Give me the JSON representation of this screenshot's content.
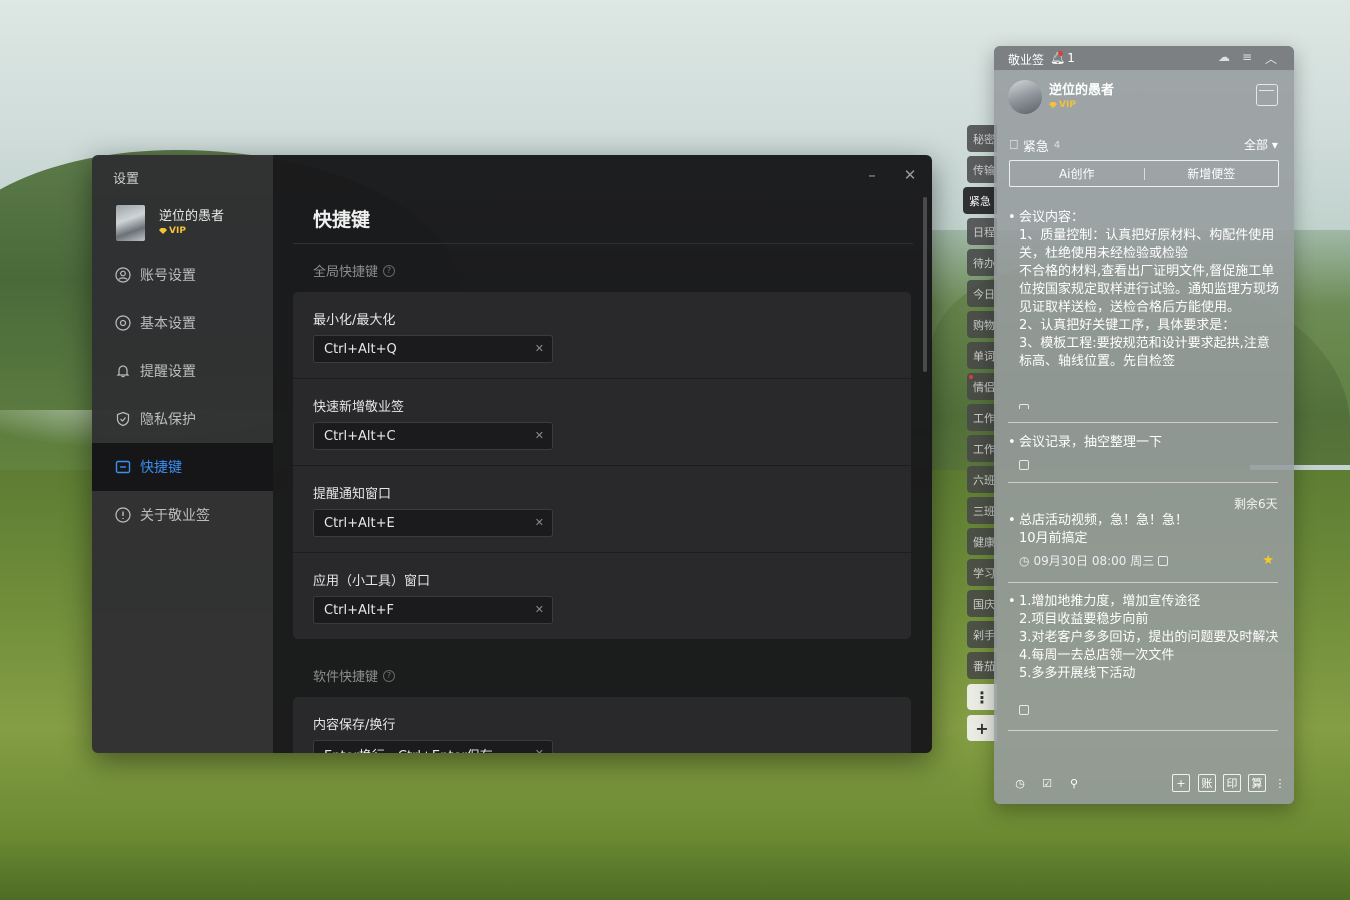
{
  "settings": {
    "window_title": "设置",
    "user": {
      "name": "逆位的愚者",
      "vip": "VIP"
    },
    "nav": [
      {
        "label": "账号设置",
        "icon": "user-icon"
      },
      {
        "label": "基本设置",
        "icon": "settings-icon"
      },
      {
        "label": "提醒设置",
        "icon": "bell-icon"
      },
      {
        "label": "隐私保护",
        "icon": "shield-icon"
      },
      {
        "label": "快捷键",
        "icon": "keyboard-icon",
        "active": true
      },
      {
        "label": "关于敬业签",
        "icon": "info-icon"
      }
    ],
    "page_title": "快捷键",
    "global_section": "全局快捷键",
    "global_shortcuts": [
      {
        "label": "最小化/最大化",
        "value": "Ctrl+Alt+Q"
      },
      {
        "label": "快速新增敬业签",
        "value": "Ctrl+Alt+C"
      },
      {
        "label": "提醒通知窗口",
        "value": "Ctrl+Alt+E"
      },
      {
        "label": "应用（小工具）窗口",
        "value": "Ctrl+Alt+F"
      }
    ],
    "software_section": "软件快捷键",
    "software_shortcuts": [
      {
        "label": "内容保存/换行",
        "value": "Enter换行，Ctrl+Enter保存"
      }
    ],
    "controls": {
      "minimize": "–",
      "close": "✕"
    },
    "accent": "#3a8ff2"
  },
  "note_panel": {
    "app_title": "敬业签",
    "bell_count": "1",
    "user": {
      "name": "逆位的愚者",
      "vip": "VIP"
    },
    "tabs": [
      "秘密",
      "传输",
      "紧急",
      "日程",
      "待办",
      "今日",
      "购物",
      "单词",
      "情侣",
      "工作",
      "工作",
      "六班",
      "三班",
      "健康",
      "学习",
      "国庆",
      "剁手",
      "番茄"
    ],
    "tab_more": "⋮",
    "tab_add": "+",
    "category": {
      "name": "紧急",
      "count": "4",
      "filter": "全部 ▾"
    },
    "buttons": {
      "ai": "Ai创作",
      "new_note": "新增便签"
    },
    "notes": [
      {
        "text": "会议内容：\n1、质量控制：认真把好原材料、构配件使用关，杜绝使用未经检验或检验\n不合格的材料,查看出厂证明文件,督促施工单位按国家规定取样进行试验。通知监理方现场见证取样送检，送检合格后方能使用。\n2、认真把好关键工序，具体要求是：\n3、模板工程:要按规范和设计要求起拱,注意标高、轴线位置。先自检签"
      },
      {
        "text": "会议记录，抽空整理一下"
      },
      {
        "text": "总店活动视频，急！急！急！\n10月前搞定",
        "remaining": "剩余6天",
        "due": "09月30日 08:00 周三",
        "starred": true
      },
      {
        "text": "1.增加地推力度，增加宣传途径\n2.项目收益要稳步向前\n3.对老客户多多回访，提出的问题要及时解决\n4.每周一去总店领一次文件\n5.多多开展线下活动"
      }
    ],
    "footer_right": [
      "+",
      "账",
      "印",
      "算"
    ],
    "star_color": "#f5cc24"
  }
}
